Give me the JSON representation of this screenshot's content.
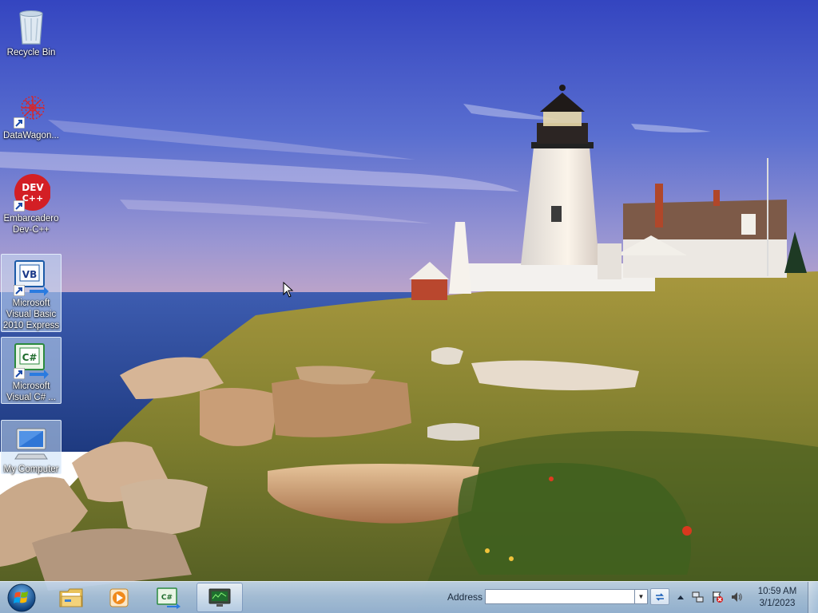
{
  "desktop": {
    "icons": [
      {
        "label": "Recycle Bin",
        "icon": "recycle-bin-icon",
        "selected": false
      },
      {
        "label": "DataWagon...",
        "icon": "datawagon-icon",
        "selected": false
      },
      {
        "label": "Embarcadero Dev-C++",
        "icon": "devcpp-icon",
        "selected": false
      },
      {
        "label": "Microsoft Visual Basic 2010 Express",
        "icon": "visual-basic-icon",
        "selected": true
      },
      {
        "label": "Microsoft Visual C# ...",
        "icon": "visual-csharp-icon",
        "selected": true
      },
      {
        "label": "My Computer",
        "icon": "my-computer-icon",
        "selected": true
      }
    ],
    "devcpp_badge": "DEV C++",
    "vb_badge": "VB",
    "cs_badge": "C#"
  },
  "taskbar": {
    "start": "start-orb-icon",
    "pinned": [
      {
        "name": "windows-explorer",
        "icon": "folder-icon",
        "active": false
      },
      {
        "name": "media-player",
        "icon": "media-player-icon",
        "active": false
      },
      {
        "name": "visual-csharp",
        "icon": "visual-csharp-icon",
        "active": false
      },
      {
        "name": "system-monitor",
        "icon": "monitor-icon",
        "active": true
      }
    ],
    "address": {
      "label": "Address",
      "value": ""
    },
    "tray": [
      "show-hidden-icons",
      "network-icon",
      "action-center-icon",
      "volume-icon"
    ],
    "clock": {
      "time": "10:59 AM",
      "date": "3/1/2023"
    }
  },
  "colors": {
    "sky_top": "#3a4fc4",
    "sky_bottom": "#a996c9",
    "sea": "#2a4c9c",
    "grass": "#8f8b38",
    "selection": "#c8def5"
  }
}
